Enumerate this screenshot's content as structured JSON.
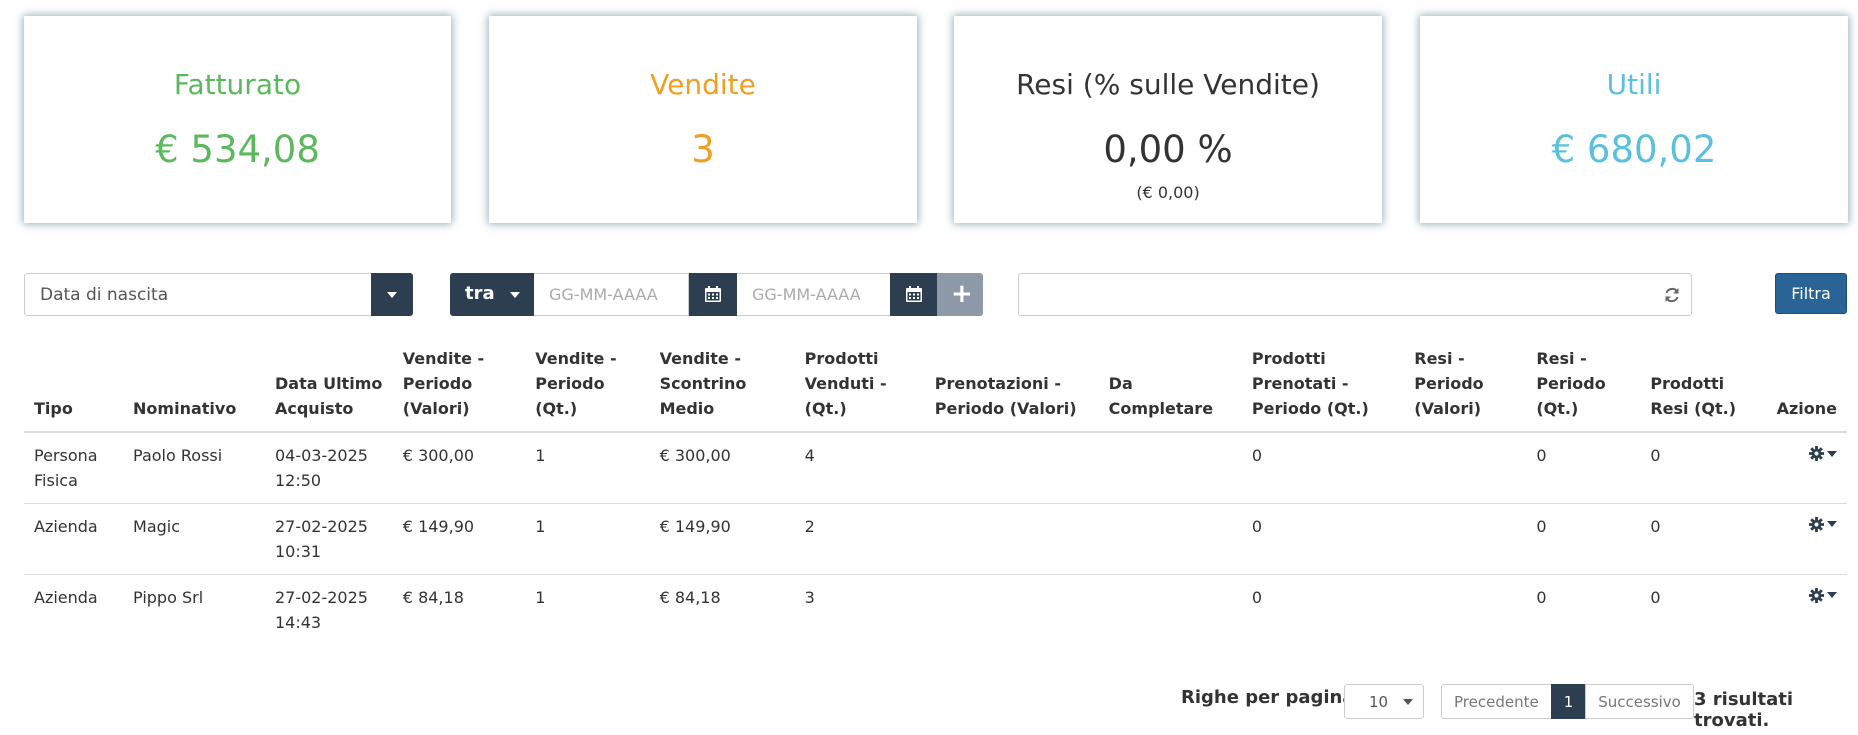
{
  "kpis": {
    "fatturato": {
      "title": "Fatturato",
      "value": "€ 534,08"
    },
    "vendite": {
      "title": "Vendite",
      "value": "3"
    },
    "resi": {
      "title": "Resi (% sulle Vendite)",
      "value": "0,00 %",
      "sub": "(€ 0,00)"
    },
    "utili": {
      "title": "Utili",
      "value": "€ 680,02"
    }
  },
  "filters": {
    "field_select": "Data di nascita",
    "operator": "tra",
    "date_placeholder": "GG-MM-AAAA",
    "search_value": "",
    "filter_button": "Filtra"
  },
  "table": {
    "headers": [
      [
        "Tipo"
      ],
      [
        "Nominativo"
      ],
      [
        "Data Ultimo",
        "Acquisto"
      ],
      [
        "Vendite -",
        "Periodo",
        "(Valori)"
      ],
      [
        "Vendite -",
        "Periodo",
        "(Qt.)"
      ],
      [
        "Vendite -",
        "Scontrino",
        "Medio"
      ],
      [
        "Prodotti",
        "Venduti -",
        "(Qt.)"
      ],
      [
        "Prenotazioni -",
        "Periodo (Valori)"
      ],
      [
        "Da",
        "Completare"
      ],
      [
        "Prodotti",
        "Prenotati -",
        "Periodo (Qt.)"
      ],
      [
        "Resi -",
        "Periodo",
        "(Valori)"
      ],
      [
        "Resi -",
        "Periodo",
        "(Qt.)"
      ],
      [
        "Prodotti",
        "Resi (Qt.)"
      ],
      [
        "Azione"
      ]
    ],
    "rows": [
      {
        "tipo": [
          "Persona",
          "Fisica"
        ],
        "nominativo": "Paolo Rossi",
        "data": [
          "04-03-2025",
          "12:50"
        ],
        "vend_valori": "€ 300,00",
        "vend_qt": "1",
        "scontrino": "€ 300,00",
        "prod_venduti": "4",
        "prenotazioni": "",
        "da_completare": "",
        "prod_prenotati": "0",
        "resi_valori": "",
        "resi_qt": "0",
        "prod_resi": "0"
      },
      {
        "tipo": [
          "Azienda"
        ],
        "nominativo": "Magic",
        "data": [
          "27-02-2025",
          "10:31"
        ],
        "vend_valori": "€ 149,90",
        "vend_qt": "1",
        "scontrino": "€ 149,90",
        "prod_venduti": "2",
        "prenotazioni": "",
        "da_completare": "",
        "prod_prenotati": "0",
        "resi_valori": "",
        "resi_qt": "0",
        "prod_resi": "0"
      },
      {
        "tipo": [
          "Azienda"
        ],
        "nominativo": "Pippo Srl",
        "data": [
          "27-02-2025",
          "14:43"
        ],
        "vend_valori": "€ 84,18",
        "vend_qt": "1",
        "scontrino": "€ 84,18",
        "prod_venduti": "3",
        "prenotazioni": "",
        "da_completare": "",
        "prod_prenotati": "0",
        "resi_valori": "",
        "resi_qt": "0",
        "prod_resi": "0"
      }
    ]
  },
  "pagination": {
    "rows_per_page_label": "Righe per pagina",
    "rows_per_page": "10",
    "prev": "Precedente",
    "current": "1",
    "next": "Successivo",
    "results": "3 risultati trovati."
  }
}
